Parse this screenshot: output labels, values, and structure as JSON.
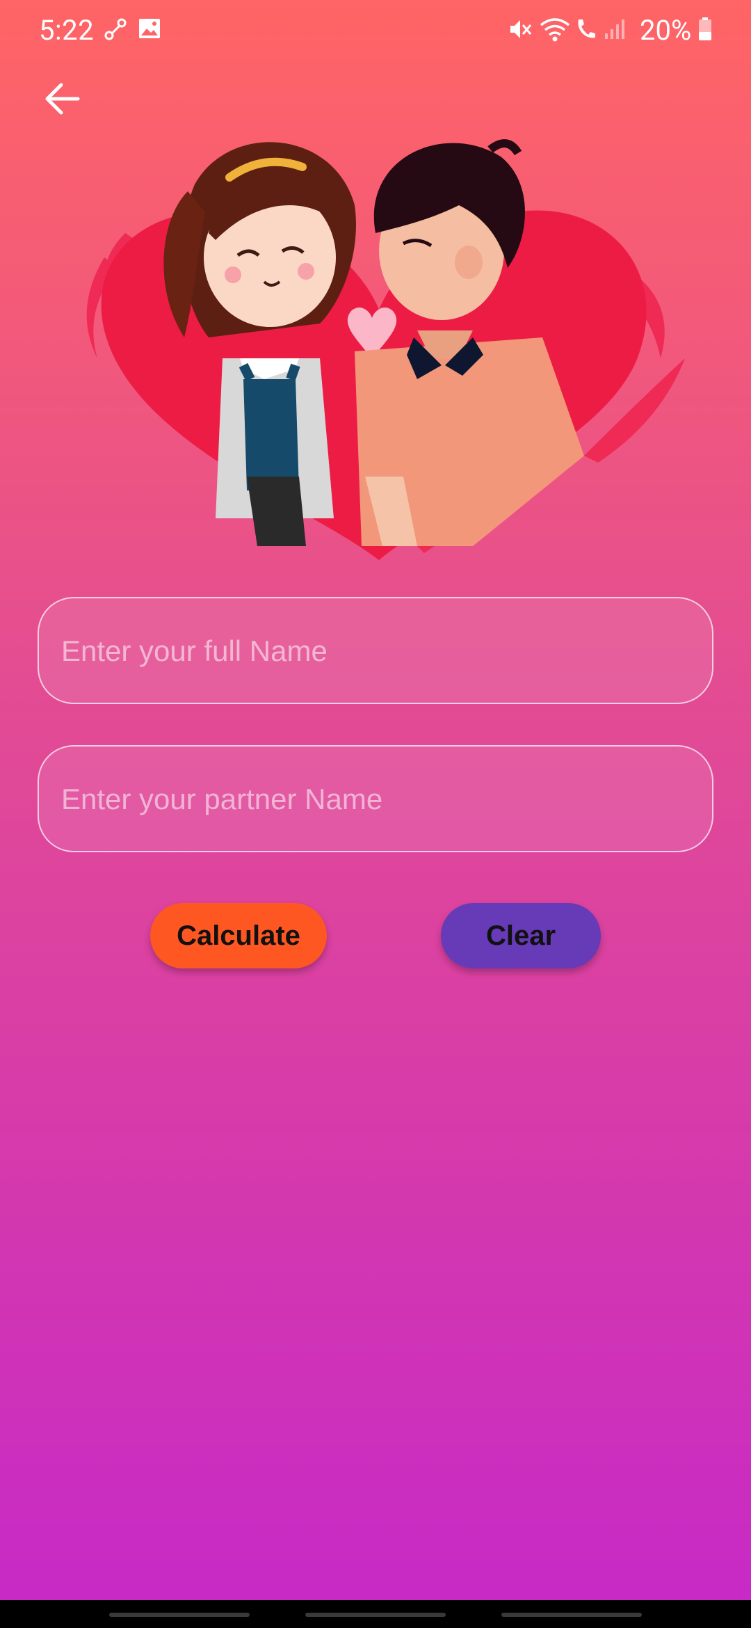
{
  "status_bar": {
    "time": "5:22",
    "battery_percent": "20%"
  },
  "header": {
    "back_icon": "arrow-left-icon"
  },
  "hero": {
    "illustration": "couple-heart-illustration"
  },
  "form": {
    "name_placeholder": "Enter your full Name",
    "name_value": "",
    "partner_placeholder": "Enter your partner Name",
    "partner_value": ""
  },
  "actions": {
    "calculate_label": "Calculate",
    "clear_label": "Clear"
  },
  "colors": {
    "calculate": "#ff5722",
    "clear": "#673ab7",
    "gradient_top": "#ff6565",
    "gradient_bottom": "#c629c7"
  }
}
